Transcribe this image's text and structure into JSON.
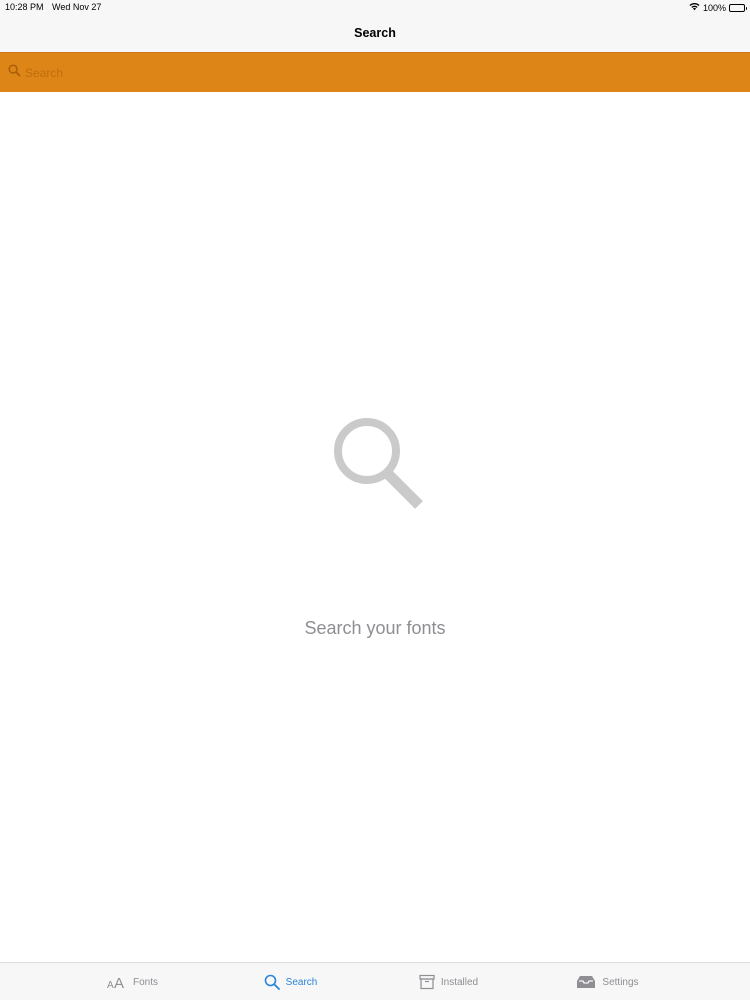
{
  "status_bar": {
    "time": "10:28 PM",
    "date": "Wed Nov 27",
    "battery": "100%",
    "icons": [
      "wifi-icon",
      "battery-icon"
    ]
  },
  "nav": {
    "title": "Search"
  },
  "search": {
    "placeholder": "Search",
    "value": ""
  },
  "empty_state": {
    "message": "Search your fonts",
    "icon": "magnifier-icon"
  },
  "tabs": [
    {
      "label": "Fonts",
      "icon": "font-size-icon",
      "active": false
    },
    {
      "label": "Search",
      "icon": "search-icon",
      "active": true
    },
    {
      "label": "Installed",
      "icon": "archive-box-icon",
      "active": false
    },
    {
      "label": "Settings",
      "icon": "tray-icon",
      "active": false
    }
  ],
  "colors": {
    "accent": "#2a85d8",
    "search_bar": "#dd8516",
    "inactive": "#8e8e93",
    "bar_bg": "#f7f7f8"
  }
}
